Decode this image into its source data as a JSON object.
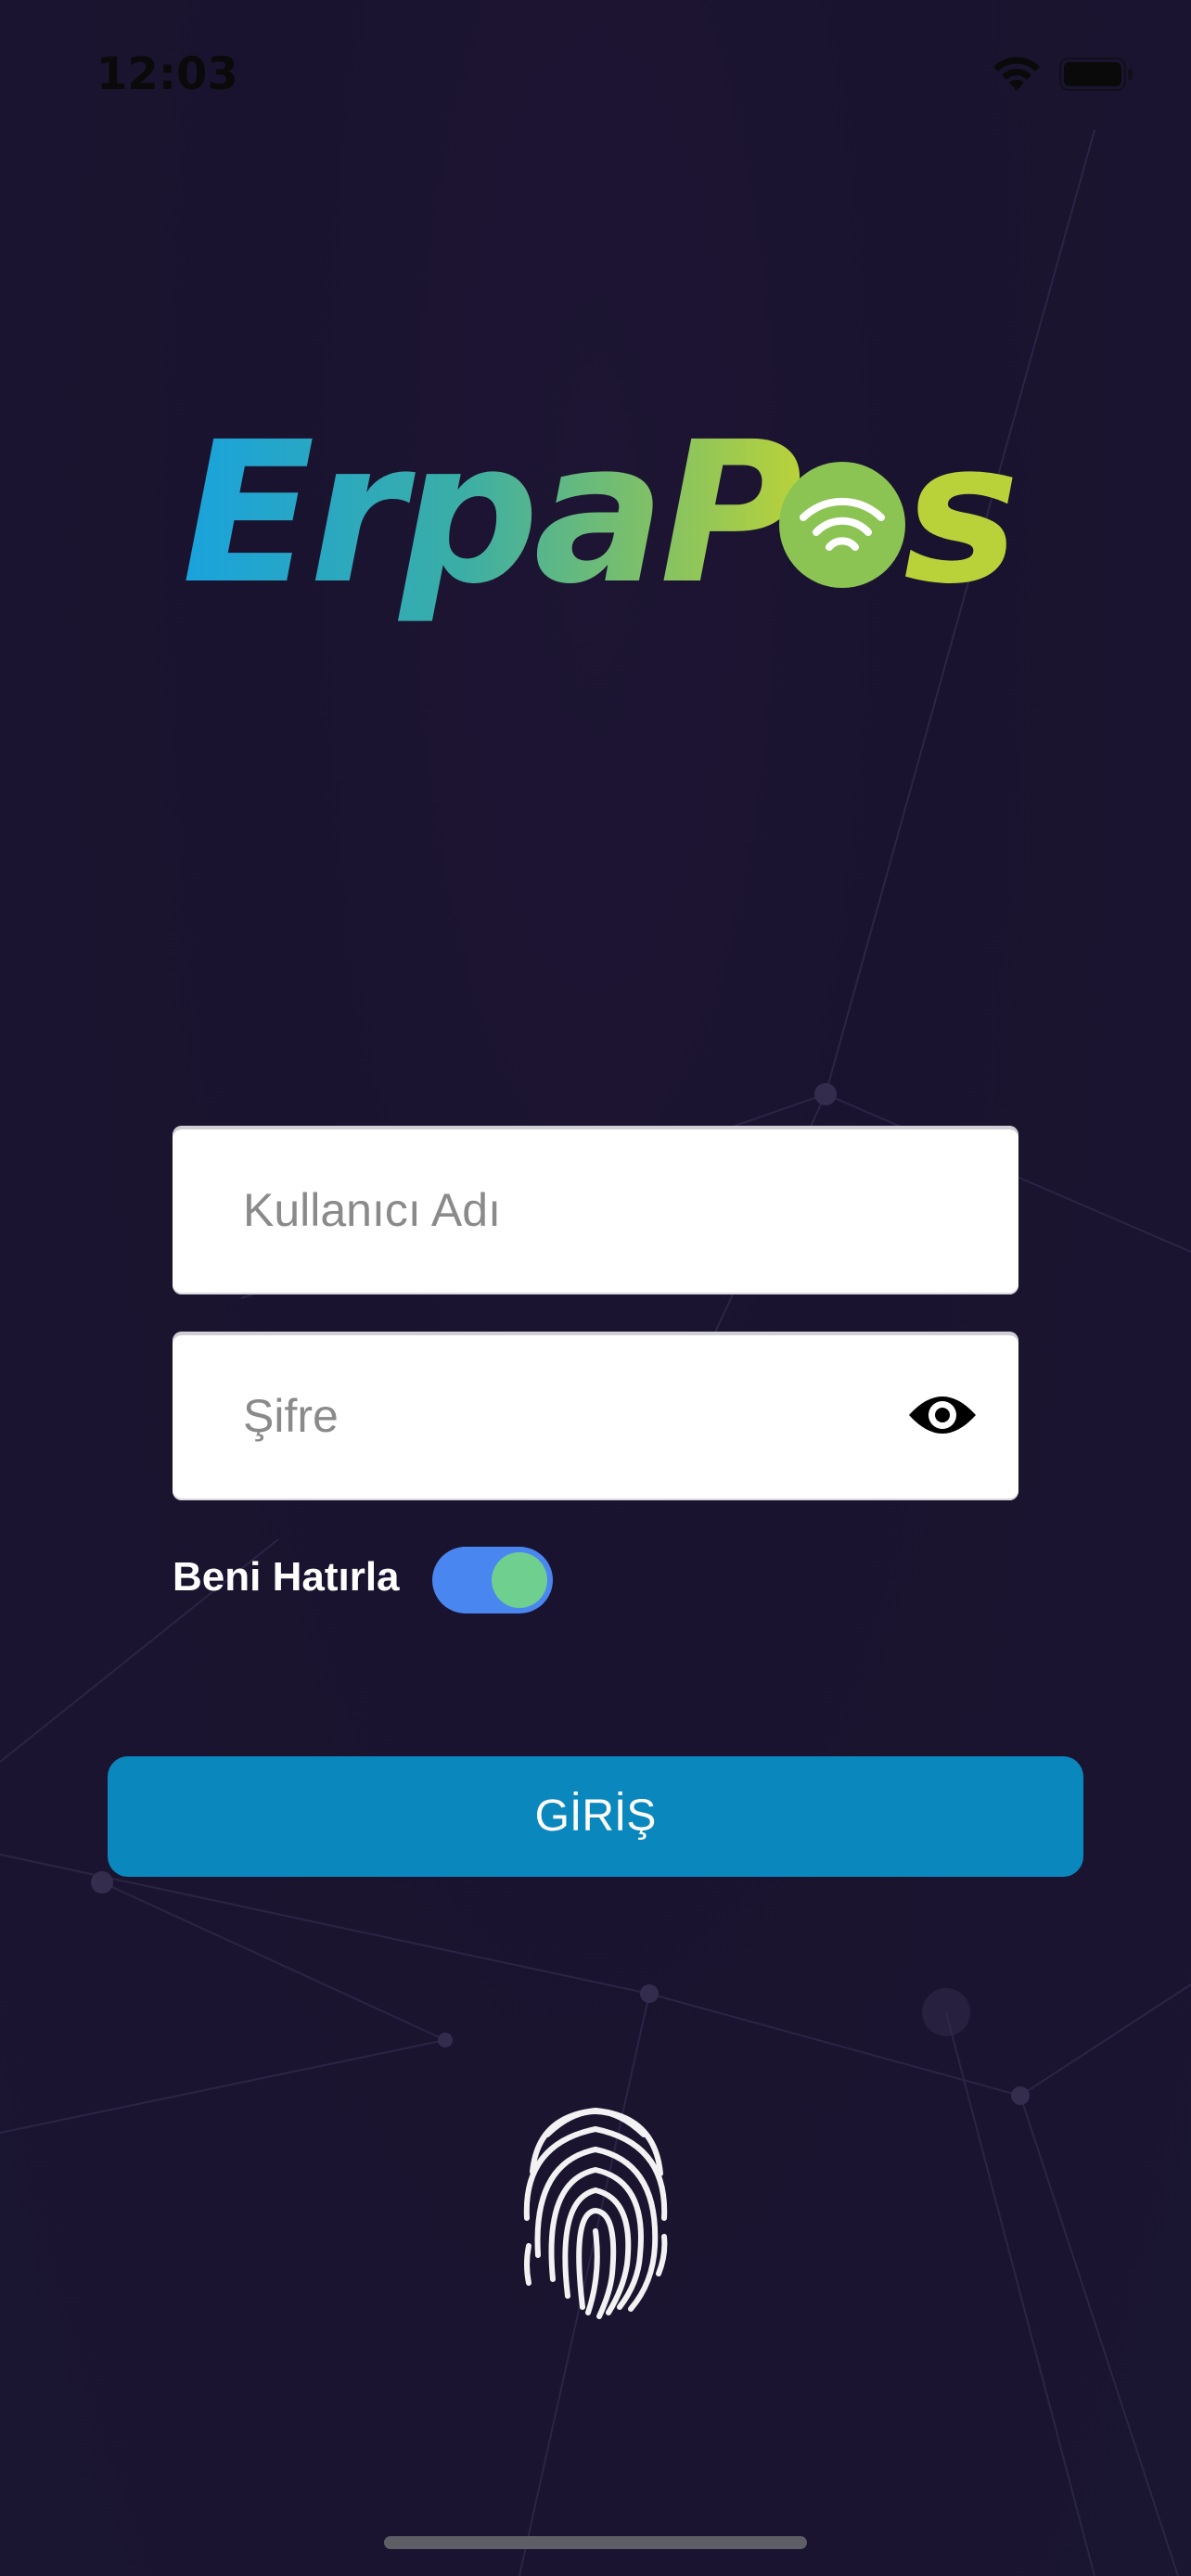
{
  "status_bar": {
    "time": "12:03"
  },
  "brand": {
    "logo_text": "ErpaPos",
    "gradient_start": "#1aa3dc",
    "gradient_end": "#b7d23c"
  },
  "login_form": {
    "username_placeholder": "Kullanıcı Adı",
    "username_value": "",
    "password_placeholder": "Şifre",
    "password_value": "",
    "remember_label": "Beni Hatırla",
    "remember_enabled": true,
    "submit_label": "GİRİŞ"
  },
  "icons": {
    "password_toggle": "eye-icon",
    "biometric": "fingerprint-icon"
  },
  "colors": {
    "background": "#1b1430",
    "button": "#0a87bd",
    "toggle_track": "#4a86f0",
    "toggle_knob": "#6ecf8e"
  }
}
